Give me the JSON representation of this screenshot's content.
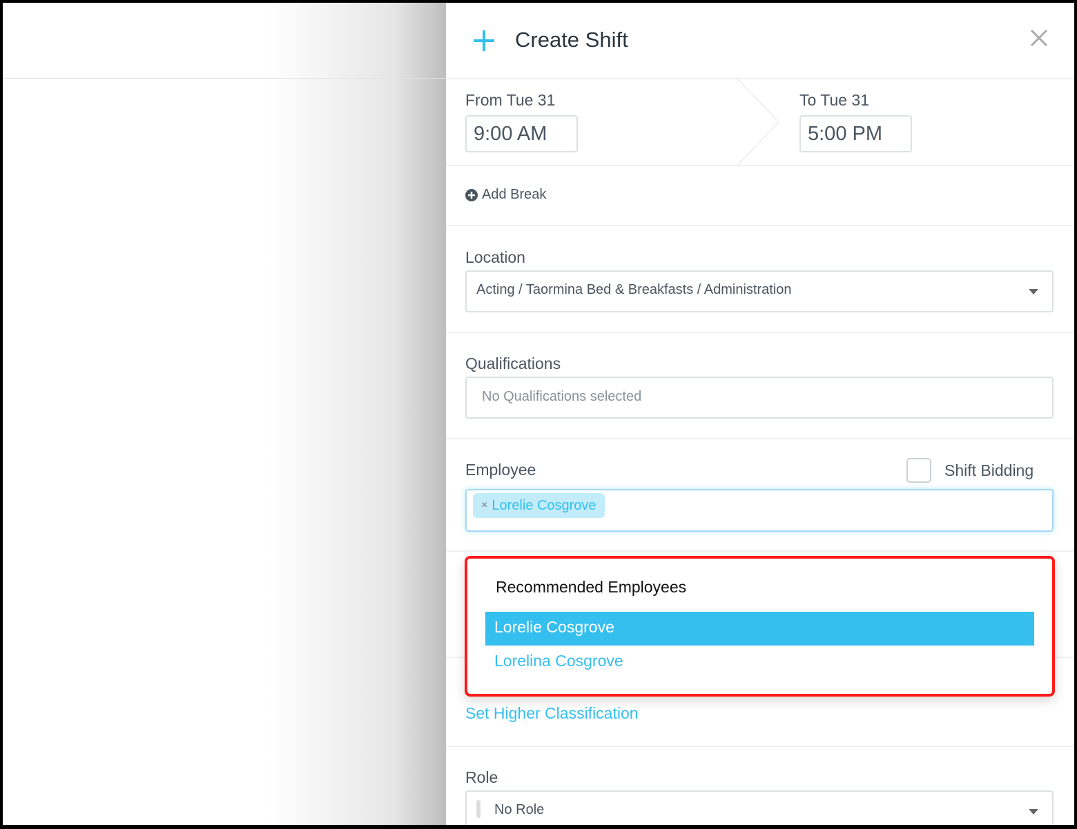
{
  "header": {
    "title": "Create Shift",
    "plus_icon": "plus-icon",
    "close_icon": "close-icon",
    "accent": "#34bfef"
  },
  "time": {
    "from_label": "From Tue 31",
    "from_value": "9:00 AM",
    "to_label": "To Tue 31",
    "to_value": "5:00 PM"
  },
  "add_break": {
    "label": "Add Break",
    "icon": "plus-circle-icon"
  },
  "location": {
    "label": "Location",
    "value": "Acting / Taormina Bed & Breakfasts / Administration"
  },
  "qualifications": {
    "label": "Qualifications",
    "placeholder": "No Qualifications selected"
  },
  "employee": {
    "label": "Employee",
    "shift_bidding_label": "Shift Bidding",
    "shift_bidding_checked": false,
    "selected_tag": "Lorelie Cosgrove",
    "tag_remove": "×"
  },
  "dropdown": {
    "heading": "Recommended Employees",
    "items": [
      {
        "label": "Lorelie Cosgrove",
        "highlighted": true
      },
      {
        "label": "Lorelina Cosgrove",
        "highlighted": false
      }
    ],
    "highlight_color": "#34bfef",
    "annotation_color": "#ff1a1a"
  },
  "higher_classification": {
    "label": "Set Higher Classification"
  },
  "role": {
    "label": "Role",
    "value": "No Role"
  }
}
